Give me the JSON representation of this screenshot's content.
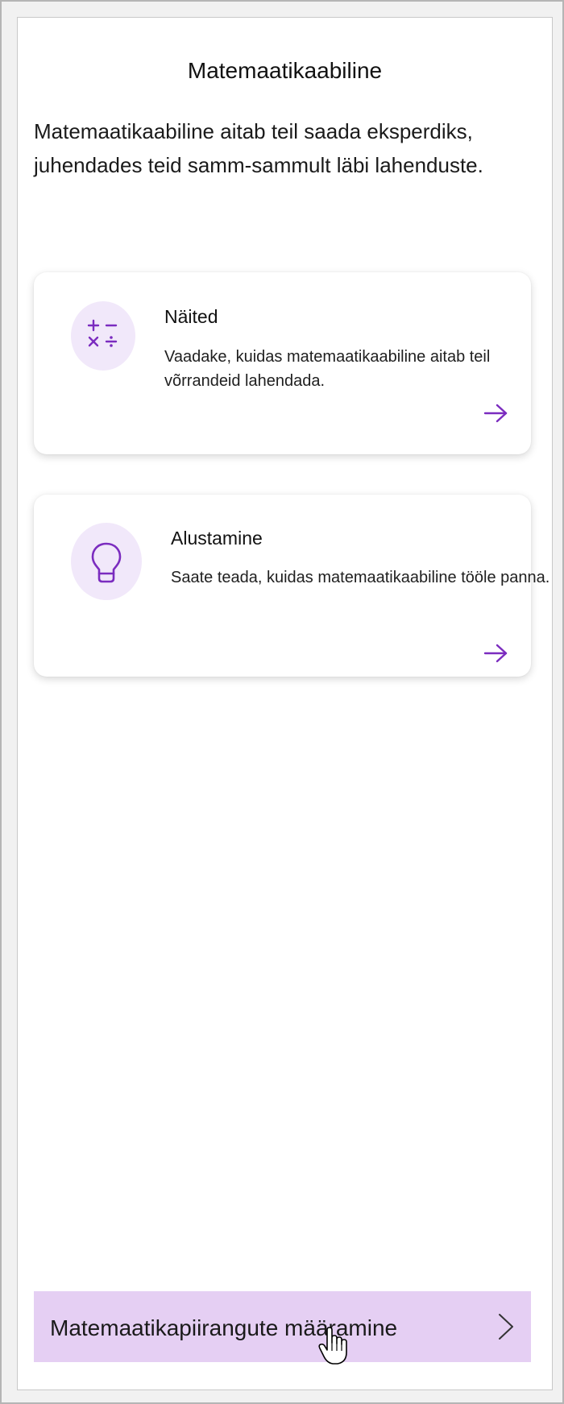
{
  "header": {
    "title": "Matemaatikaabiline"
  },
  "intro": {
    "text": "Matemaatikaabiline aitab teil saada eksperdiks, juhendades teid samm-sammult läbi lahenduste."
  },
  "cards": [
    {
      "title": "Näited",
      "description": "Vaadake, kuidas matemaatikaabiline aitab teil võrrandeid lahendada.",
      "icon": "math-operators-icon"
    },
    {
      "title": "Alustamine",
      "description": "Saate teada, kuidas matemaatikaabiline tööle panna.",
      "icon": "lightbulb-icon"
    }
  ],
  "footer": {
    "button_label": "Matemaatikapiirangute määramine"
  },
  "colors": {
    "accent": "#7b2cbf",
    "icon_bg": "#f1e8fa",
    "footer_bg": "#e5cff3"
  }
}
